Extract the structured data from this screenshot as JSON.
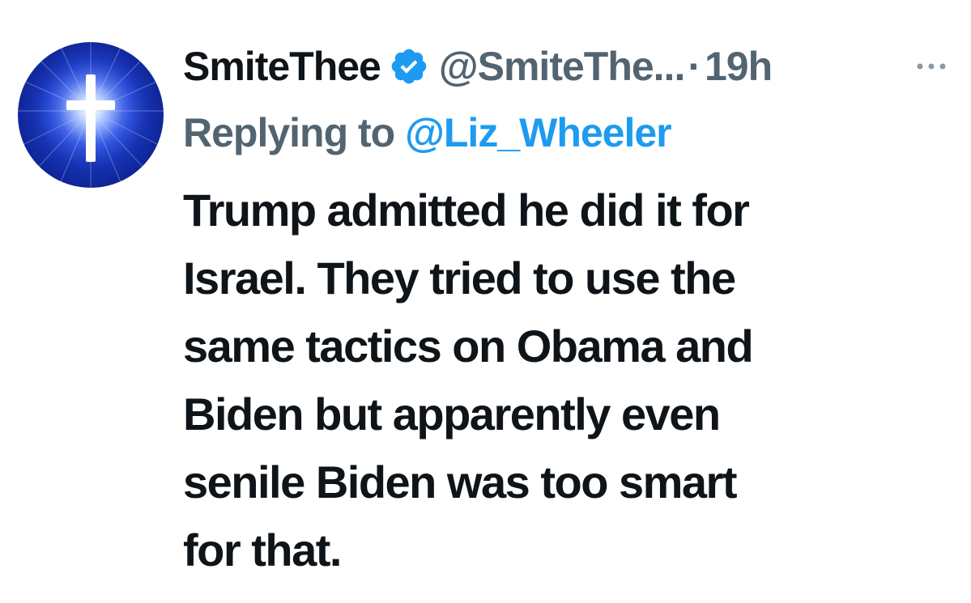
{
  "tweet": {
    "author": {
      "display_name": "SmiteThee",
      "handle": "@SmiteThe...",
      "verified": true,
      "avatar_icon": "glowing-cross-icon"
    },
    "separator": "·",
    "timestamp": "19h",
    "more_icon": "more-options-icon",
    "reply": {
      "prefix": "Replying to",
      "mention": "@Liz_Wheeler"
    },
    "text_lines": [
      "Trump admitted he did it for",
      "Israel. They tried to use the",
      "same tactics on Obama and",
      "Biden but apparently even",
      "senile Biden was too smart",
      "for that."
    ]
  },
  "colors": {
    "text_primary": "#0f1419",
    "text_secondary": "#536471",
    "accent": "#1d9bf0",
    "background": "#ffffff"
  }
}
